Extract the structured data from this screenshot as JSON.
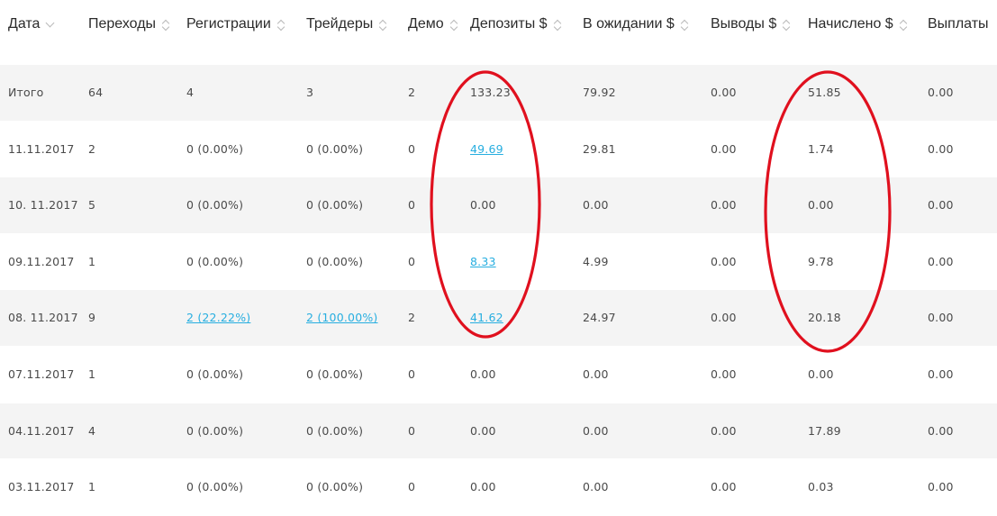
{
  "columns": [
    {
      "label": "Дата",
      "sort": "chevron"
    },
    {
      "label": "Переходы",
      "sort": "both"
    },
    {
      "label": "Регистрации",
      "sort": "both"
    },
    {
      "label": "Трейдеры",
      "sort": "both"
    },
    {
      "label": "Демо",
      "sort": "both"
    },
    {
      "label": "Депозиты $",
      "sort": "both"
    },
    {
      "label": "В ожидании $",
      "sort": "both"
    },
    {
      "label": "Выводы $",
      "sort": "both"
    },
    {
      "label": "Начислено $",
      "sort": "both"
    },
    {
      "label": "Выплаты",
      "sort": "none"
    }
  ],
  "rows": [
    {
      "shaded": true,
      "cells": [
        "Итого",
        "64",
        "4",
        "3",
        "2",
        "133.23",
        "79.92",
        "0.00",
        "51.85",
        "0.00"
      ],
      "links": []
    },
    {
      "shaded": false,
      "cells": [
        "11.11.2017",
        "2",
        "0 (0.00%)",
        "0 (0.00%)",
        "0",
        "49.69",
        "29.81",
        "0.00",
        "1.74",
        "0.00"
      ],
      "links": [
        5
      ]
    },
    {
      "shaded": true,
      "cells": [
        "10. 11.2017",
        "5",
        "0 (0.00%)",
        "0 (0.00%)",
        "0",
        "0.00",
        "0.00",
        "0.00",
        "0.00",
        "0.00"
      ],
      "links": []
    },
    {
      "shaded": false,
      "cells": [
        "09.11.2017",
        "1",
        "0 (0.00%)",
        "0 (0.00%)",
        "0",
        "8.33",
        "4.99",
        "0.00",
        "9.78",
        "0.00"
      ],
      "links": [
        5
      ]
    },
    {
      "shaded": true,
      "cells": [
        "08. 11.2017",
        "9",
        "2 (22.22%)",
        "2 (100.00%)",
        "2",
        "41.62",
        "24.97",
        "0.00",
        "20.18",
        "0.00"
      ],
      "links": [
        2,
        3,
        5
      ]
    },
    {
      "shaded": false,
      "cells": [
        "07.11.2017",
        "1",
        "0 (0.00%)",
        "0 (0.00%)",
        "0",
        "0.00",
        "0.00",
        "0.00",
        "0.00",
        "0.00"
      ],
      "links": []
    },
    {
      "shaded": true,
      "cells": [
        "04.11.2017",
        "4",
        "0 (0.00%)",
        "0 (0.00%)",
        "0",
        "0.00",
        "0.00",
        "0.00",
        "17.89",
        "0.00"
      ],
      "links": []
    },
    {
      "shaded": false,
      "cells": [
        "03.11.2017",
        "1",
        "0 (0.00%)",
        "0 (0.00%)",
        "0",
        "0.00",
        "0.00",
        "0.00",
        "0.03",
        "0.00"
      ],
      "links": []
    }
  ],
  "colors": {
    "link": "#27aee0",
    "row_shade": "#f4f4f4",
    "annotation": "#e0101e"
  }
}
